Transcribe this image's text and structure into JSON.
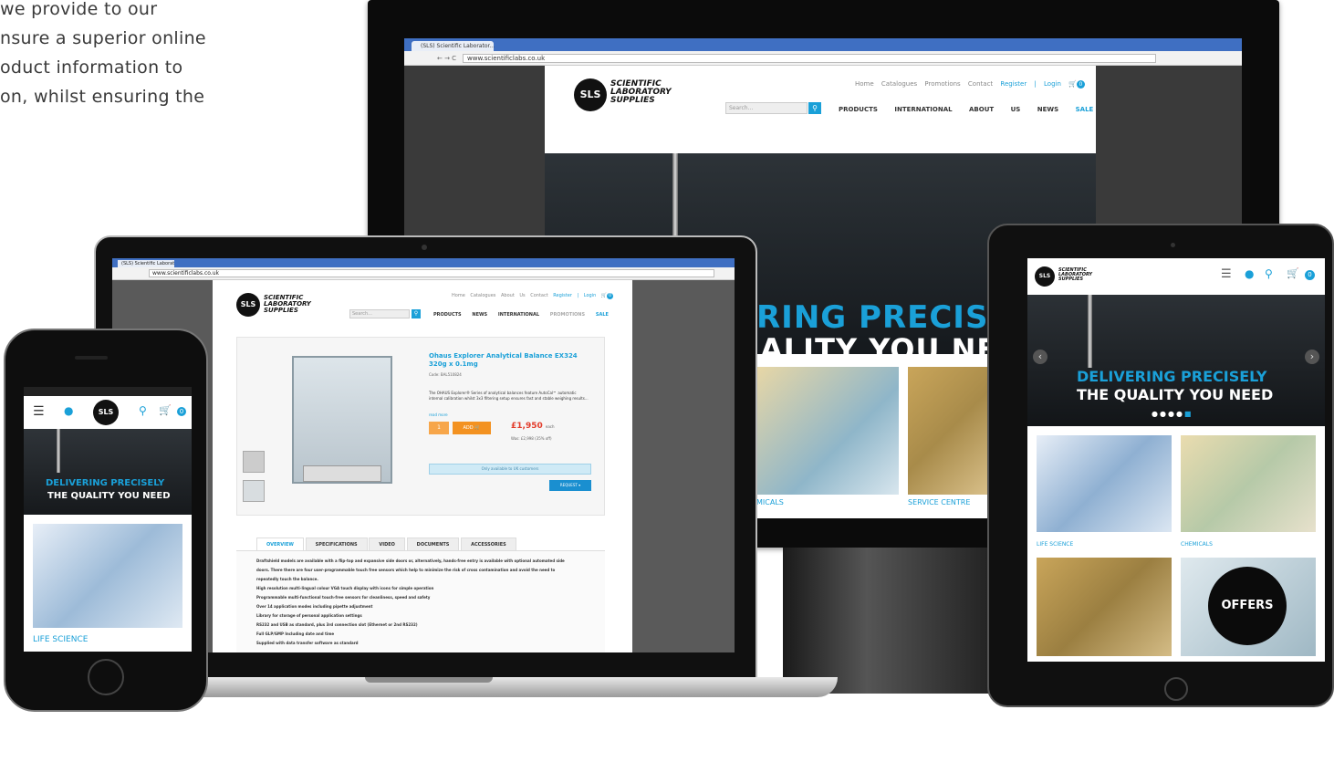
{
  "intro": {
    "lines": [
      "we provide to our",
      "nsure a superior online",
      "oduct information to",
      "on, whilst ensuring the"
    ]
  },
  "brand": {
    "logo_mark": "SLS",
    "name_line1": "SCIENTIFIC",
    "name_line2": "LABORATORY",
    "name_line3": "SUPPLIES",
    "accent_color": "#1aa0d8"
  },
  "monitor": {
    "tab_title": "(SLS) Scientific Laborator...",
    "url": "www.scientificlabs.co.uk",
    "top_links": [
      "Home",
      "Catalogues",
      "Promotions",
      "Contact"
    ],
    "register_login": "Register | Login",
    "cart_count": "0",
    "search_placeholder": "Search...",
    "main_nav": [
      "PRODUCTS",
      "INTERNATIONAL",
      "ABOUT US",
      "NEWS",
      "SALE"
    ],
    "hero_line1": "RING PRECISELY",
    "hero_line2": "ALITY YOU NEED",
    "tiles": [
      "MICALS",
      "SERVICE CENTRE"
    ]
  },
  "laptop": {
    "url": "www.scientificlabs.co.uk",
    "top_links": [
      "Home",
      "Catalogues",
      "About Us",
      "Contact"
    ],
    "register_login": "Register | Login",
    "cart_count": "0",
    "search_placeholder": "Search...",
    "main_nav": [
      "PRODUCTS",
      "NEWS",
      "INTERNATIONAL",
      "PROMOTIONS",
      "SALE"
    ],
    "product_title": "Ohaus Explorer Analytical Balance EX324 320g x 0.1mg",
    "product_code": "Code: BAL510824",
    "product_desc": "The OHAUS Explorer® Series of analytical balances feature AutoCal™ automatic internal calibration whilst 3x3 filtering setup ensures fast and stable weighing results...",
    "read_more": "read more",
    "qty": "1",
    "add_label": "ADD",
    "price": "£1,950",
    "price_suffix": "each",
    "was_price": "Was: £2,998 (35% off)",
    "uk_only": "Only available to UK customers",
    "request_label": "REQUEST",
    "tabs": [
      "OVERVIEW",
      "SPECIFICATIONS",
      "VIDEO",
      "DOCUMENTS",
      "ACCESSORIES"
    ],
    "overview_lines": [
      "Draftshield models are available with a flip-top and expansive side doors or, alternatively, hands-free entry is available with optional automated side",
      "doors. There there are four user-programmable touch free sensors which help to minimize the risk of cross contamination and avoid the need to",
      "repeatedly touch the balance.",
      "High resolution multi-lingual colour VGA touch display with icons for simple operation",
      "Programmable multi-functional touch-free sensors for cleanliness, speed and safety",
      "Over 14 application modes including pipette adjustment",
      "Library for storage of personal application settings",
      "RS232 and USB as standard, plus 3rd connection slot (Ethernet or 2nd RS232)",
      "Full GLP/GMP Including date and time",
      "Supplied with data transfer software as standard"
    ]
  },
  "phone": {
    "cart_count": "0",
    "hero_line1": "DELIVERING PRECISELY",
    "hero_line2": "THE QUALITY YOU NEED",
    "tile_label": "LIFE SCIENCE"
  },
  "tablet": {
    "cart_count": "0",
    "hero_line1": "DELIVERING PRECISELY",
    "hero_line2": "THE QUALITY YOU NEED",
    "tiles": [
      "LIFE SCIENCE",
      "CHEMICALS",
      "",
      "OFFERS"
    ]
  }
}
